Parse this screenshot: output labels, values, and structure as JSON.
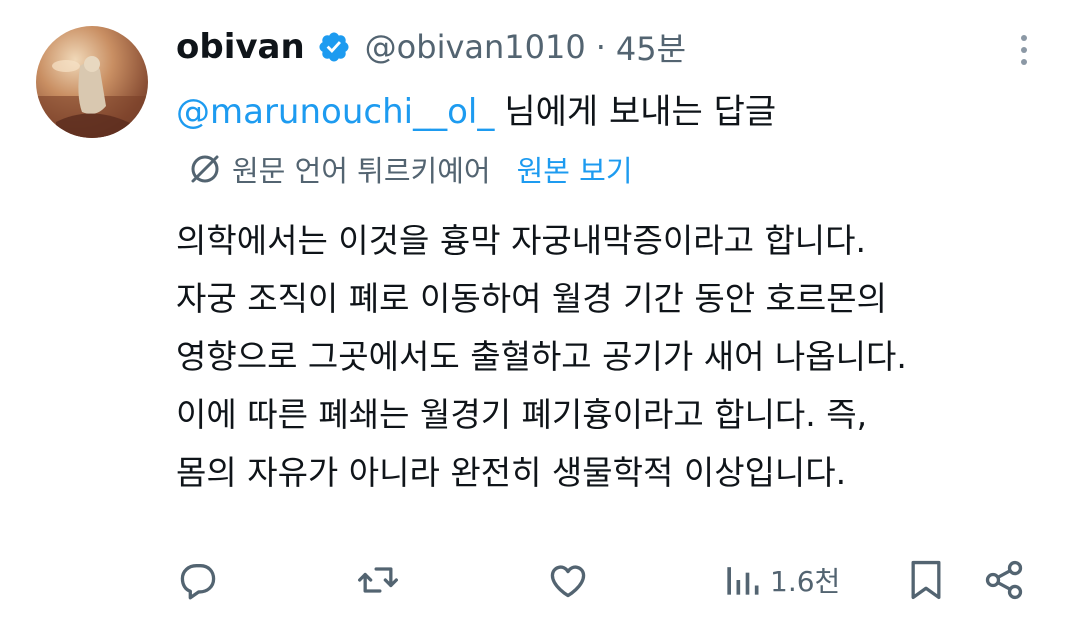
{
  "post": {
    "author_name": "obivan",
    "handle": "@obivan1010",
    "separator": "·",
    "time": "45분",
    "reply_to": "@marunouchi__ol_",
    "reply_suffix": "님에게 보내는 답글",
    "translation": {
      "source_language": "원문 언어 튀르키예어",
      "show_original": "원본 보기"
    },
    "body_lines": [
      "의학에서는 이것을 흉막 자궁내막증이라고 합니다.",
      "자궁 조직이 폐로 이동하여 월경 기간 동안 호르몬의",
      "영향으로 그곳에서도 출혈하고 공기가 새어 나옵니다.",
      "이에 따른 폐쇄는 월경기 폐기흉이라고 합니다. 즉,",
      "몸의 자유가 아니라 완전히 생물학적 이상입니다."
    ],
    "actions": {
      "views": "1.6천"
    }
  },
  "icons": {
    "verified": "verified-badge-icon",
    "more": "more-vertical-icon",
    "translate": "translate-icon",
    "reply": "reply-icon",
    "repost": "repost-icon",
    "like": "like-icon",
    "views": "views-icon",
    "bookmark": "bookmark-icon",
    "share": "share-icon"
  },
  "colors": {
    "text": "#0f1419",
    "secondary": "#536471",
    "accent": "#1d9bf0"
  }
}
